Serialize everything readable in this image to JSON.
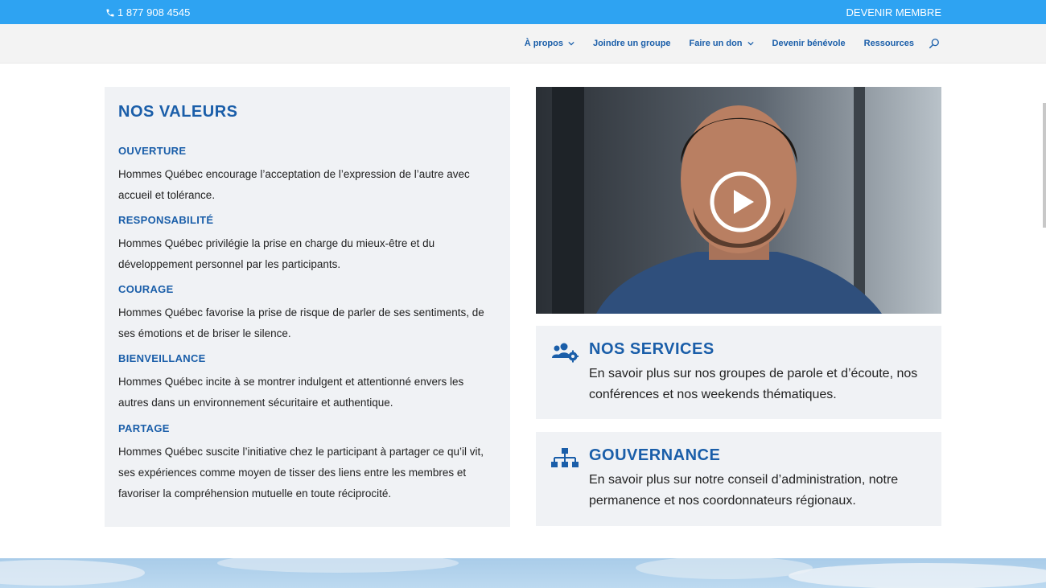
{
  "topbar": {
    "phone": "1 877 908 4545",
    "member_link": "DEVENIR MEMBRE"
  },
  "nav": {
    "items": [
      "À propos",
      "Joindre un groupe",
      "Faire un don",
      "Devenir bénévole",
      "Ressources"
    ]
  },
  "values": {
    "title": "NOS VALEURS",
    "items": [
      {
        "title": "OUVERTURE",
        "text": "Hommes Québec encourage l’acceptation de l’expression de l’autre avec accueil et tolérance."
      },
      {
        "title": "RESPONSABILITÉ",
        "text": "Hommes Québec privilégie la prise en charge du mieux-être et du développement personnel par les participants."
      },
      {
        "title": "COURAGE",
        "text": "Hommes Québec favorise la prise de risque de parler de ses sentiments, de ses émotions et de briser le silence."
      },
      {
        "title": "BIENVEILLANCE",
        "text": "Hommes Québec incite à se montrer indulgent et attentionné envers les autres dans un environnement sécuritaire et authentique."
      },
      {
        "title": "PARTAGE",
        "text": "Hommes Québec suscite l’initiative chez le participant à partager ce qu’il vit, ses expériences comme moyen de tisser des liens entre les membres et favoriser la compréhension mutuelle en toute réciprocité."
      }
    ]
  },
  "services": {
    "title": "NOS SERVICES",
    "text": "En savoir plus sur nos groupes de parole et d’écoute, nos conférences et nos weekends thématiques.",
    "icon": "users-cog-icon"
  },
  "governance": {
    "title": "GOUVERNANCE",
    "text": "En savoir plus sur notre conseil d’administration, notre permanence et nos coordonnateurs régionaux.",
    "icon": "sitemap-icon"
  },
  "colors": {
    "topbar": "#2ea3f2",
    "accent": "#1a5ea9",
    "card": "#f0f2f5"
  }
}
